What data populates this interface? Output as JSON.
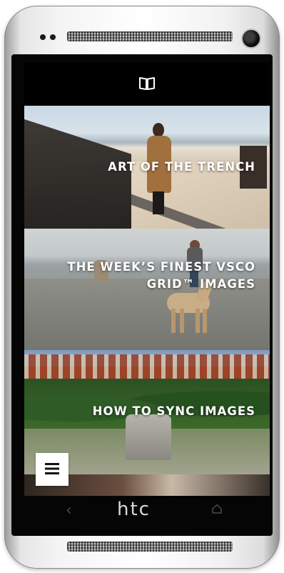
{
  "device": {
    "brand_logo": "htc"
  },
  "app_bar": {
    "icon": "book-icon"
  },
  "feed": {
    "items": [
      {
        "title": "ART OF THE TRENCH"
      },
      {
        "title": "THE WEEK’S FINEST VSCO GRID™ IMAGES"
      },
      {
        "title": "HOW TO SYNC IMAGES"
      }
    ]
  },
  "menu_button": {
    "icon": "hamburger-menu-icon"
  },
  "nav": {
    "back_symbol": "‹",
    "home_icon": "home-icon"
  }
}
